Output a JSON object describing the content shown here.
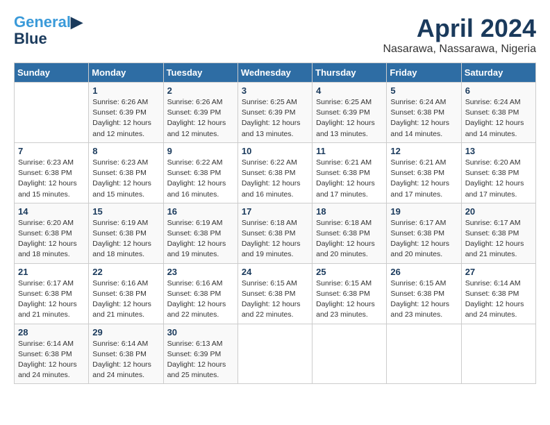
{
  "logo": {
    "line1": "General",
    "line2": "Blue"
  },
  "header": {
    "month": "April 2024",
    "location": "Nasarawa, Nassarawa, Nigeria"
  },
  "weekdays": [
    "Sunday",
    "Monday",
    "Tuesday",
    "Wednesday",
    "Thursday",
    "Friday",
    "Saturday"
  ],
  "weeks": [
    [
      {
        "day": "",
        "info": ""
      },
      {
        "day": "1",
        "info": "Sunrise: 6:26 AM\nSunset: 6:39 PM\nDaylight: 12 hours\nand 12 minutes."
      },
      {
        "day": "2",
        "info": "Sunrise: 6:26 AM\nSunset: 6:39 PM\nDaylight: 12 hours\nand 12 minutes."
      },
      {
        "day": "3",
        "info": "Sunrise: 6:25 AM\nSunset: 6:39 PM\nDaylight: 12 hours\nand 13 minutes."
      },
      {
        "day": "4",
        "info": "Sunrise: 6:25 AM\nSunset: 6:39 PM\nDaylight: 12 hours\nand 13 minutes."
      },
      {
        "day": "5",
        "info": "Sunrise: 6:24 AM\nSunset: 6:38 PM\nDaylight: 12 hours\nand 14 minutes."
      },
      {
        "day": "6",
        "info": "Sunrise: 6:24 AM\nSunset: 6:38 PM\nDaylight: 12 hours\nand 14 minutes."
      }
    ],
    [
      {
        "day": "7",
        "info": "Sunrise: 6:23 AM\nSunset: 6:38 PM\nDaylight: 12 hours\nand 15 minutes."
      },
      {
        "day": "8",
        "info": "Sunrise: 6:23 AM\nSunset: 6:38 PM\nDaylight: 12 hours\nand 15 minutes."
      },
      {
        "day": "9",
        "info": "Sunrise: 6:22 AM\nSunset: 6:38 PM\nDaylight: 12 hours\nand 16 minutes."
      },
      {
        "day": "10",
        "info": "Sunrise: 6:22 AM\nSunset: 6:38 PM\nDaylight: 12 hours\nand 16 minutes."
      },
      {
        "day": "11",
        "info": "Sunrise: 6:21 AM\nSunset: 6:38 PM\nDaylight: 12 hours\nand 17 minutes."
      },
      {
        "day": "12",
        "info": "Sunrise: 6:21 AM\nSunset: 6:38 PM\nDaylight: 12 hours\nand 17 minutes."
      },
      {
        "day": "13",
        "info": "Sunrise: 6:20 AM\nSunset: 6:38 PM\nDaylight: 12 hours\nand 17 minutes."
      }
    ],
    [
      {
        "day": "14",
        "info": "Sunrise: 6:20 AM\nSunset: 6:38 PM\nDaylight: 12 hours\nand 18 minutes."
      },
      {
        "day": "15",
        "info": "Sunrise: 6:19 AM\nSunset: 6:38 PM\nDaylight: 12 hours\nand 18 minutes."
      },
      {
        "day": "16",
        "info": "Sunrise: 6:19 AM\nSunset: 6:38 PM\nDaylight: 12 hours\nand 19 minutes."
      },
      {
        "day": "17",
        "info": "Sunrise: 6:18 AM\nSunset: 6:38 PM\nDaylight: 12 hours\nand 19 minutes."
      },
      {
        "day": "18",
        "info": "Sunrise: 6:18 AM\nSunset: 6:38 PM\nDaylight: 12 hours\nand 20 minutes."
      },
      {
        "day": "19",
        "info": "Sunrise: 6:17 AM\nSunset: 6:38 PM\nDaylight: 12 hours\nand 20 minutes."
      },
      {
        "day": "20",
        "info": "Sunrise: 6:17 AM\nSunset: 6:38 PM\nDaylight: 12 hours\nand 21 minutes."
      }
    ],
    [
      {
        "day": "21",
        "info": "Sunrise: 6:17 AM\nSunset: 6:38 PM\nDaylight: 12 hours\nand 21 minutes."
      },
      {
        "day": "22",
        "info": "Sunrise: 6:16 AM\nSunset: 6:38 PM\nDaylight: 12 hours\nand 21 minutes."
      },
      {
        "day": "23",
        "info": "Sunrise: 6:16 AM\nSunset: 6:38 PM\nDaylight: 12 hours\nand 22 minutes."
      },
      {
        "day": "24",
        "info": "Sunrise: 6:15 AM\nSunset: 6:38 PM\nDaylight: 12 hours\nand 22 minutes."
      },
      {
        "day": "25",
        "info": "Sunrise: 6:15 AM\nSunset: 6:38 PM\nDaylight: 12 hours\nand 23 minutes."
      },
      {
        "day": "26",
        "info": "Sunrise: 6:15 AM\nSunset: 6:38 PM\nDaylight: 12 hours\nand 23 minutes."
      },
      {
        "day": "27",
        "info": "Sunrise: 6:14 AM\nSunset: 6:38 PM\nDaylight: 12 hours\nand 24 minutes."
      }
    ],
    [
      {
        "day": "28",
        "info": "Sunrise: 6:14 AM\nSunset: 6:38 PM\nDaylight: 12 hours\nand 24 minutes."
      },
      {
        "day": "29",
        "info": "Sunrise: 6:14 AM\nSunset: 6:38 PM\nDaylight: 12 hours\nand 24 minutes."
      },
      {
        "day": "30",
        "info": "Sunrise: 6:13 AM\nSunset: 6:39 PM\nDaylight: 12 hours\nand 25 minutes."
      },
      {
        "day": "",
        "info": ""
      },
      {
        "day": "",
        "info": ""
      },
      {
        "day": "",
        "info": ""
      },
      {
        "day": "",
        "info": ""
      }
    ]
  ]
}
